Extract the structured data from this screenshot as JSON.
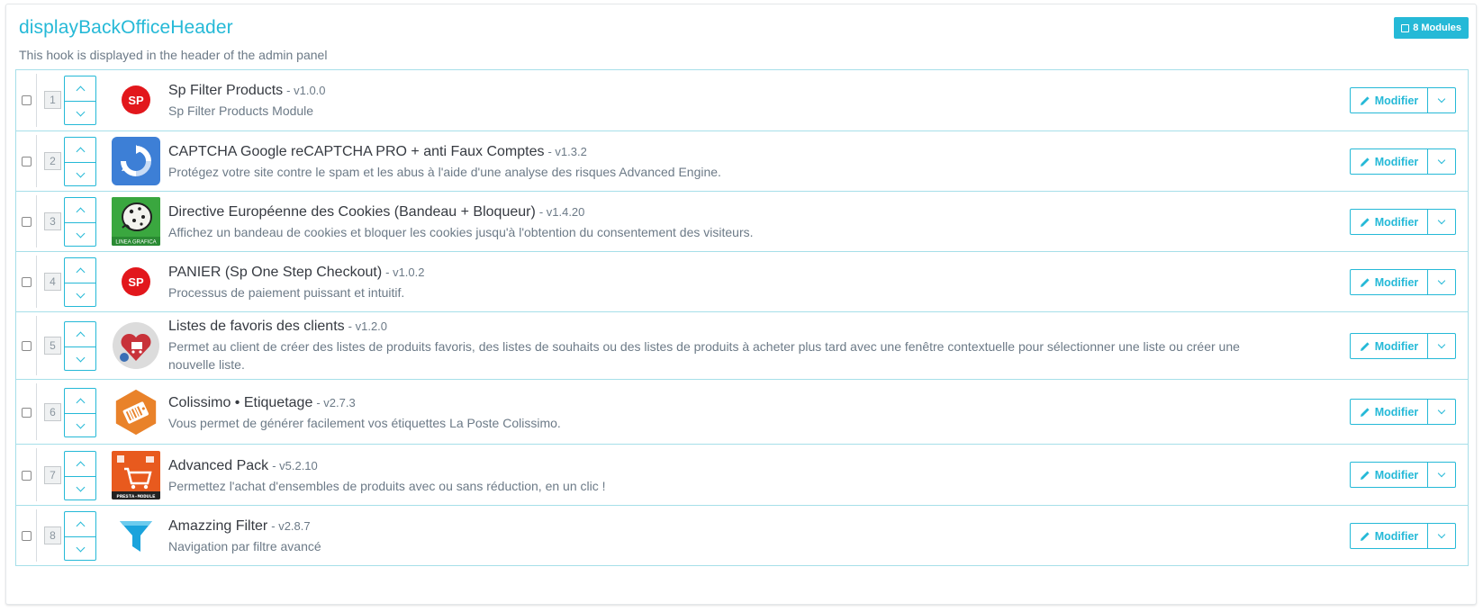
{
  "hook": {
    "title": "displayBackOfficeHeader",
    "description": "This hook is displayed in the header of the admin panel",
    "badge": "8 Modules"
  },
  "actions": {
    "modify_label": "Modifier"
  },
  "modules": [
    {
      "position": "1",
      "name": "Sp Filter Products",
      "version": "- v1.0.0",
      "description": "Sp Filter Products Module",
      "logo": "sp-logo-icon",
      "logo_text": "SP"
    },
    {
      "position": "2",
      "name": "CAPTCHA Google reCAPTCHA PRO + anti Faux Comptes",
      "version": "- v1.3.2",
      "description": "Protégez votre site contre le spam et les abus à l'aide d'une analyse des risques Advanced Engine.",
      "logo": "recaptcha-icon"
    },
    {
      "position": "3",
      "name": "Directive Européenne des Cookies (Bandeau + Bloqueur)",
      "version": "- v1.4.20",
      "description": "Affichez un bandeau de cookies et bloquer les cookies jusqu'à l'obtention du consentement des visiteurs.",
      "logo": "cookie-icon",
      "logo_text": "LINEA GRAFICA"
    },
    {
      "position": "4",
      "name": "PANIER (Sp One Step Checkout)",
      "version": "- v1.0.2",
      "description": "Processus de paiement puissant et intuitif.",
      "logo": "sp-logo-icon",
      "logo_text": "SP"
    },
    {
      "position": "5",
      "name": "Listes de favoris des clients",
      "version": "- v1.2.0",
      "description": "Permet au client de créer des listes de produits favoris, des listes de souhaits ou des listes de produits à acheter plus tard avec une fenêtre contextuelle pour sélectionner une liste ou créer une nouvelle liste.",
      "logo": "heart-cart-icon"
    },
    {
      "position": "6",
      "name": "Colissimo • Etiquetage",
      "version": "- v2.7.3",
      "description": "Vous permet de générer facilement vos étiquettes La Poste Colissimo.",
      "logo": "colissimo-label-icon"
    },
    {
      "position": "7",
      "name": "Advanced Pack",
      "version": "- v5.2.10",
      "description": "Permettez l'achat d'ensembles de produits avec ou sans réduction, en un clic !",
      "logo": "advanced-pack-icon",
      "logo_text": "PRESTA-MODULE"
    },
    {
      "position": "8",
      "name": "Amazzing Filter",
      "version": "- v2.8.7",
      "description": "Navigation par filtre avancé",
      "logo": "funnel-icon"
    }
  ],
  "colors": {
    "accent": "#25b9d7",
    "sp_red": "#e2171c",
    "text": "#363a41",
    "muted": "#6c7a87"
  }
}
